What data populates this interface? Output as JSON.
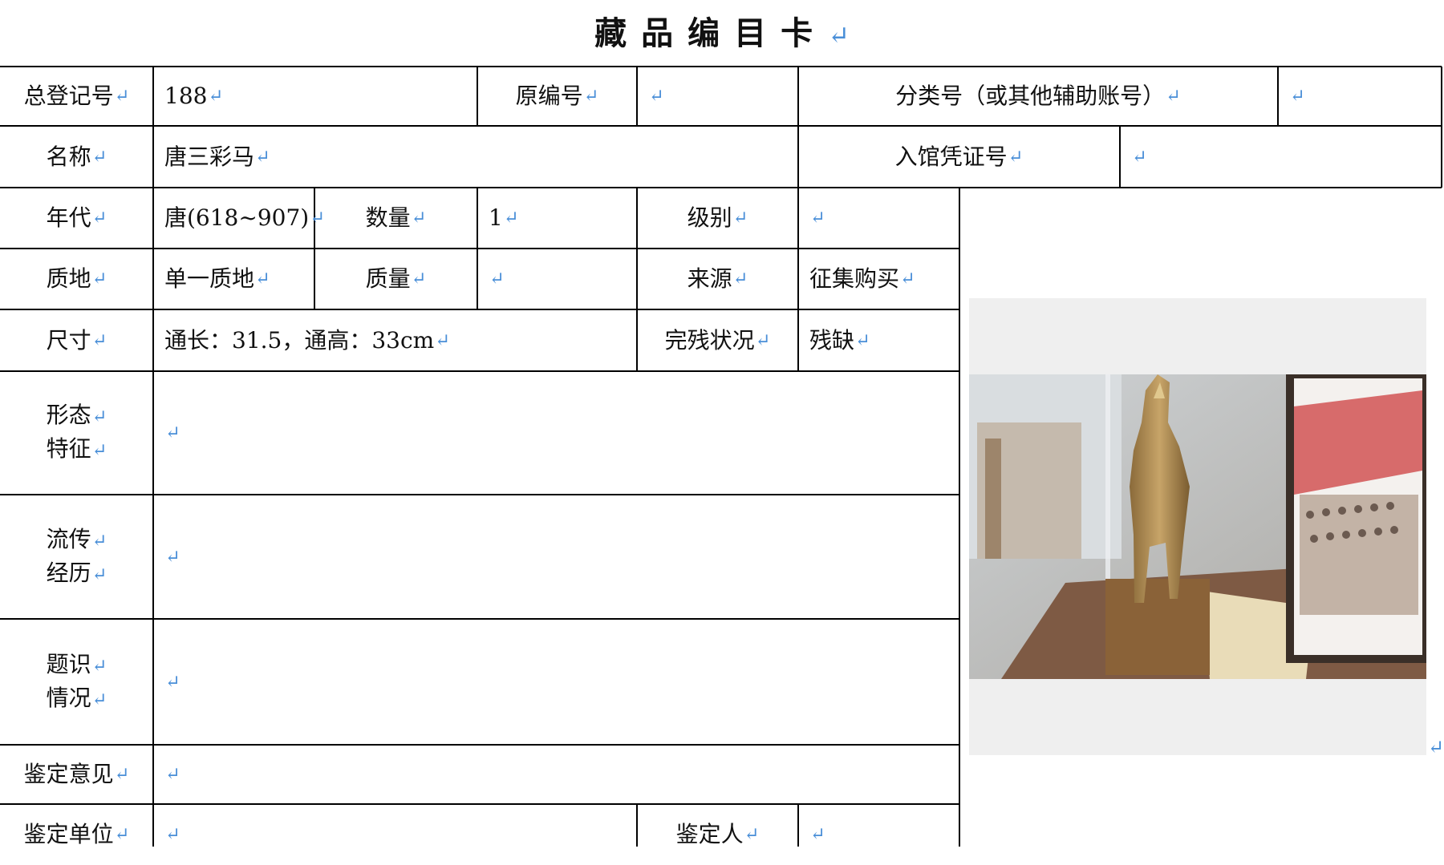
{
  "card": {
    "title": "藏品编目卡",
    "return_mark": "↵",
    "rows": {
      "r1": {
        "label_total": "总登记号",
        "total_value": "188",
        "label_orig": "原编号",
        "orig_value": "",
        "label_class": "分类号（或其他辅助账号）",
        "class_value": ""
      },
      "r2": {
        "label_name": "名称",
        "name_value": "唐三彩马",
        "label_voucher": "入馆凭证号",
        "voucher_value": ""
      },
      "r3": {
        "label_era": "年代",
        "era_value": "唐(618~907)",
        "label_qty": "数量",
        "qty_value": "1",
        "label_grade": "级别",
        "grade_value": ""
      },
      "r4": {
        "label_material": "质地",
        "material_value": "单一质地",
        "label_mass": "质量",
        "mass_value": "",
        "label_source": "来源",
        "source_value": "征集购买"
      },
      "r5": {
        "label_size": "尺寸",
        "size_value": "通长：31.5，通高：33cm",
        "label_condition": "完残状况",
        "condition_value": "残缺"
      },
      "r6": {
        "label_line1": "形态",
        "label_line2": "特征",
        "value": ""
      },
      "r7": {
        "label_line1": "流传",
        "label_line2": "经历",
        "value": ""
      },
      "r8": {
        "label_line1": "题识",
        "label_line2": "情况",
        "value": ""
      },
      "r9": {
        "label": "鉴定意见",
        "value": ""
      },
      "r10": {
        "label_unit": "鉴定单位",
        "unit_value": "",
        "label_person": "鉴定人",
        "person_value": ""
      }
    },
    "photo": {
      "subject": "tang-sancai-horse-photo"
    }
  }
}
